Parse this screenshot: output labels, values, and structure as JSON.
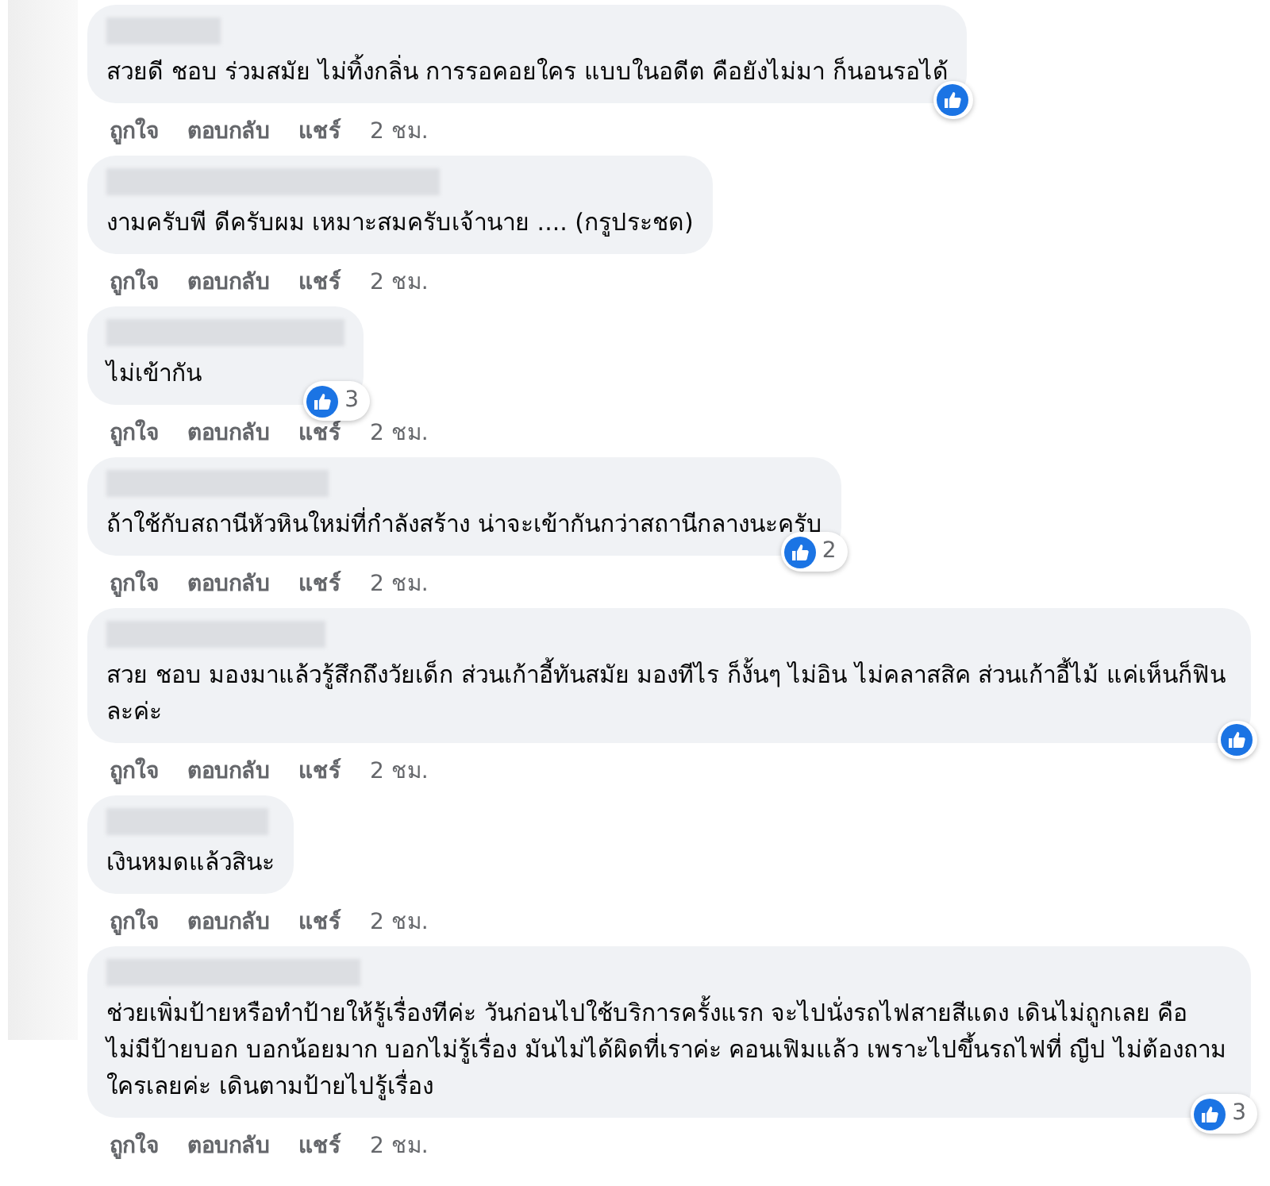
{
  "comments": [
    {
      "text": "สวยดี ชอบ ร่วมสมัย ไม่ทิ้งกลิ่น การรอคอยใคร แบบในอดีต คือยังไม่มา ก็นอนรอได้",
      "reacted": true,
      "actions": [
        "ถูกใจ",
        "ตอบกลับ",
        "แชร์"
      ],
      "time": "2 ชม."
    },
    {
      "text": "งามครับพี ดีครับผม เหมาะสมครับเจ้านาย .... (กรูประชด)",
      "reacted": false,
      "actions": [
        "ถูกใจ",
        "ตอบกลับ",
        "แชร์"
      ],
      "time": "2 ชม."
    },
    {
      "text": "ไม่เข้ากัน",
      "reacted": true,
      "reaction_count": "3",
      "actions": [
        "ถูกใจ",
        "ตอบกลับ",
        "แชร์"
      ],
      "time": "2 ชม."
    },
    {
      "text": "ถ้าใช้กับสถานีหัวหินใหม่ที่กำลังสร้าง น่าจะเข้ากันกว่าสถานีกลางนะครับ",
      "reacted": true,
      "reaction_count": "2",
      "actions": [
        "ถูกใจ",
        "ตอบกลับ",
        "แชร์"
      ],
      "time": "2 ชม."
    },
    {
      "text": "สวย ชอบ มองมาแล้วรู้สึกถึงวัยเด็ก ส่วนเก้าอี้ทันสมัย มองทีไร ก็งั้นๆ ไม่อิน ไม่คลาสสิค ส่วนเก้าอี้ไม้ แค่เห็นก็ฟินละค่ะ",
      "reacted": true,
      "actions": [
        "ถูกใจ",
        "ตอบกลับ",
        "แชร์"
      ],
      "time": "2 ชม."
    },
    {
      "text": "เงินหมดแล้วสินะ",
      "reacted": false,
      "actions": [
        "ถูกใจ",
        "ตอบกลับ",
        "แชร์"
      ],
      "time": "2 ชม."
    },
    {
      "text": "ช่วยเพิ่มป้ายหรือทำป้ายให้รู้เรื่องทีค่ะ วันก่อนไปใช้บริการครั้งแรก จะไปนั่งรถไฟสายสีแดง เดินไม่ถูกเลย คือไม่มีป้ายบอก บอกน้อยมาก บอกไม่รู้เรื่อง มันไม่ได้ผิดที่เราค่ะ คอนเฟิมแล้ว เพราะไปขึ้นรถไฟที่ ญีป ไม่ต้องถามใครเลยค่ะ เดินตามป้ายไปรู้เรื่อง",
      "reacted": true,
      "reaction_count": "3",
      "actions": [
        "ถูกใจ",
        "ตอบกลับ",
        "แชร์"
      ],
      "time": "2 ชม."
    }
  ]
}
